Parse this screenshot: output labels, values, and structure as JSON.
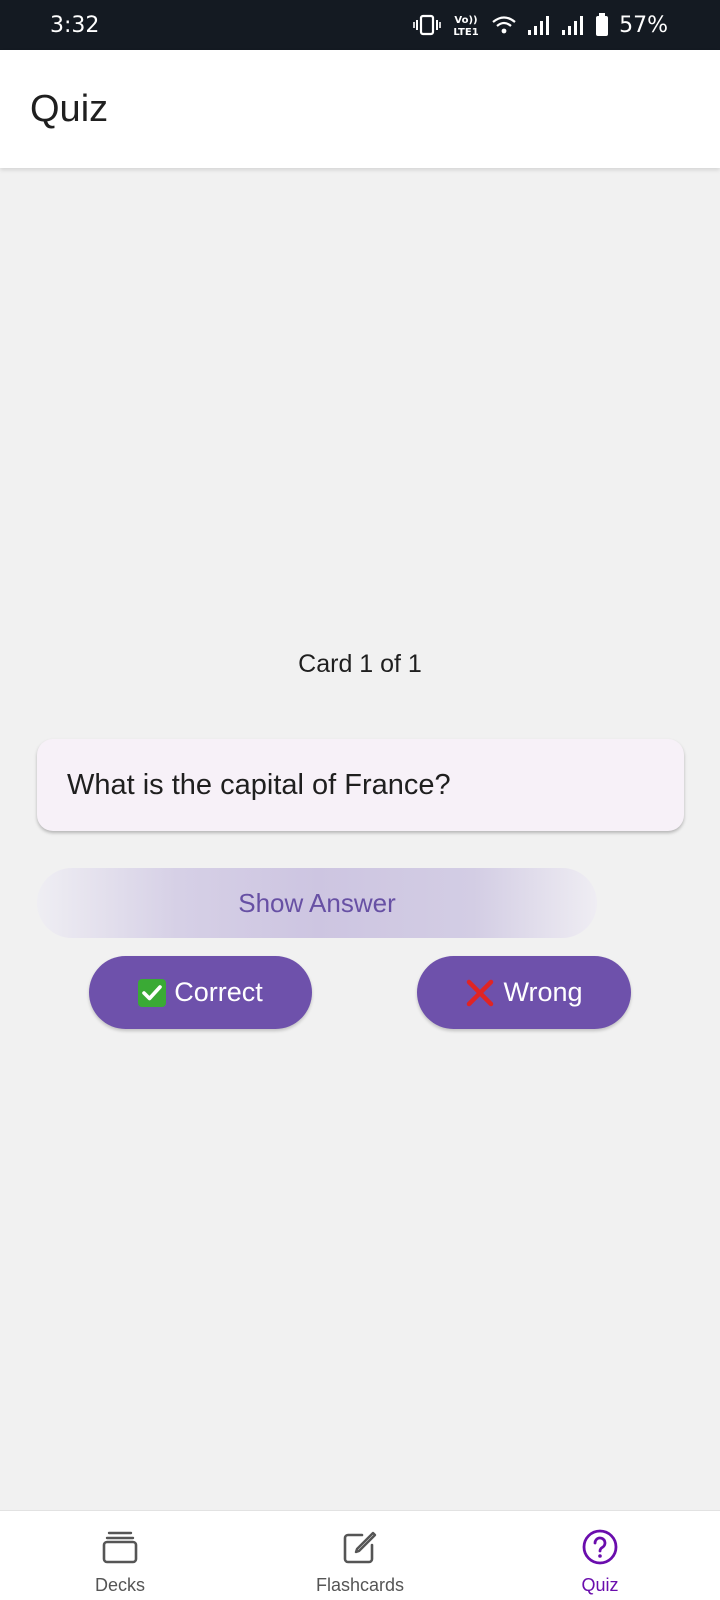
{
  "status_bar": {
    "time": "3:32",
    "battery": "57%",
    "icons": [
      "vibrate-icon",
      "volte-icon",
      "wifi-icon",
      "signal-icon",
      "signal-icon",
      "battery-icon"
    ]
  },
  "app_bar": {
    "title": "Quiz"
  },
  "quiz": {
    "counter": "Card 1 of 1",
    "question": "What is the capital of France?",
    "show_answer_label": "Show Answer",
    "correct_label": "Correct",
    "wrong_label": "Wrong"
  },
  "bottom_nav": {
    "items": [
      {
        "label": "Decks",
        "icon": "decks-icon"
      },
      {
        "label": "Flashcards",
        "icon": "edit-icon"
      },
      {
        "label": "Quiz",
        "icon": "help-circle-icon",
        "active": true
      }
    ]
  },
  "colors": {
    "accent": "#6750a4",
    "button": "#6e51ab",
    "active_nav": "#6a0dad",
    "status_bar": "#141a22"
  }
}
